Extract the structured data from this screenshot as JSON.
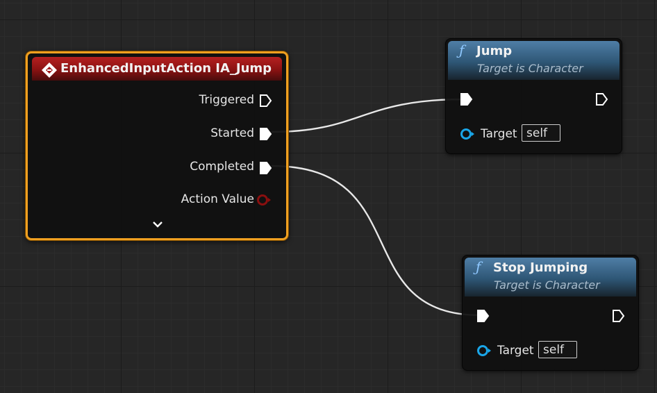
{
  "event_node": {
    "title": "EnhancedInputAction IA_Jump",
    "pins": {
      "triggered": "Triggered",
      "started": "Started",
      "completed": "Completed",
      "action_value": "Action Value"
    }
  },
  "jump_node": {
    "title": "Jump",
    "subtitle": "Target is Character",
    "target_label": "Target",
    "target_value": "self"
  },
  "stop_node": {
    "title": "Stop Jumping",
    "subtitle": "Target is Character",
    "target_label": "Target",
    "target_value": "self"
  },
  "colors": {
    "event_header": "#a01818",
    "function_header": "#3f6a8e",
    "selection": "#f0a020",
    "exec_pin": "#ffffff",
    "object_pin": "#1aa6e8",
    "action_value_pin": "#8a0f0f"
  },
  "icons": {
    "event": "event-diamond-icon",
    "function": "function-f-icon",
    "expand": "chevron-down-icon"
  }
}
